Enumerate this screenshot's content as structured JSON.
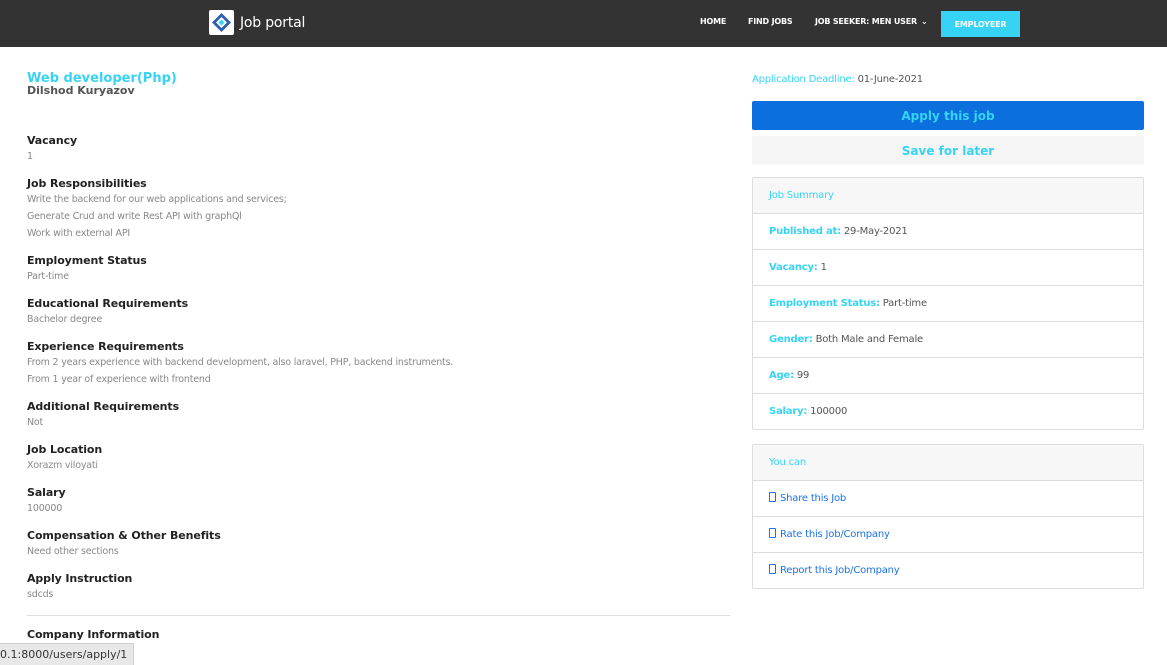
{
  "nav": {
    "brand": "Job portal",
    "home": "HOME",
    "find_jobs": "FIND JOBS",
    "user_menu": "JOB SEEKER: MEN USER",
    "employer": "EMPLOYEER"
  },
  "job": {
    "title": "Web developer(Php)",
    "company": "Dilshod Kuryazov"
  },
  "sections": [
    {
      "title": "Vacancy",
      "lines": [
        "1"
      ]
    },
    {
      "title": "Job Responsibilities",
      "lines": [
        "Write the backend for our web applications and services;",
        "Generate Crud and write Rest API with graphQl",
        "Work with external API"
      ]
    },
    {
      "title": "Employment Status",
      "lines": [
        "Part-time"
      ]
    },
    {
      "title": "Educational Requirements",
      "lines": [
        "Bachelor degree"
      ]
    },
    {
      "title": "Experience Requirements",
      "lines": [
        "From 2 years experience with backend development, also laravel, PHP, backend instruments.",
        "From 1 year of experience with frontend"
      ]
    },
    {
      "title": "Additional Requirements",
      "lines": [
        "Not"
      ]
    },
    {
      "title": "Job Location",
      "lines": [
        "Xorazm viloyati"
      ]
    },
    {
      "title": "Salary",
      "lines": [
        "100000"
      ]
    },
    {
      "title": "Compensation & Other Benefits",
      "lines": [
        "Need other sections"
      ]
    },
    {
      "title": "Apply Instruction",
      "lines": [
        "sdcds"
      ]
    },
    {
      "title": "Company Information",
      "lines": []
    }
  ],
  "sidebar": {
    "deadline_label": "Application Deadline:",
    "deadline_value": "01-June-2021",
    "apply_label": "Apply this job",
    "save_label": "Save for later",
    "summary": {
      "heading": "Job Summary",
      "rows": [
        {
          "key": "Published at:",
          "value": "29-May-2021"
        },
        {
          "key": "Vacancy:",
          "value": "1"
        },
        {
          "key": "Employment Status:",
          "value": "Part-time"
        },
        {
          "key": "Gender:",
          "value": "Both Male and Female"
        },
        {
          "key": "Age:",
          "value": "99"
        },
        {
          "key": "Salary:",
          "value": "100000"
        }
      ]
    },
    "actions": {
      "heading": "You can",
      "items": [
        "Share this Job",
        "Rate this Job/Company",
        "Report this Job/Company"
      ]
    }
  },
  "statusbar": {
    "url": "0.1:8000/users/apply/1"
  },
  "colors": {
    "accent": "#36d3f5",
    "primary": "#0b6fdd",
    "nav_bg": "#333333",
    "link": "#1a73e8"
  }
}
